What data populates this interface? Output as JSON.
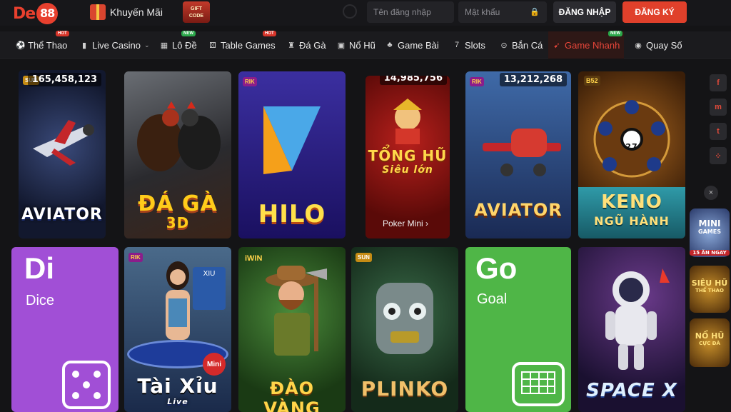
{
  "header": {
    "logo_text": "De",
    "logo_badge": "88",
    "promo_label": "Khuyến Mãi",
    "gift_code": "GIFT CODE",
    "username_placeholder": "Tên đăng nhập",
    "password_placeholder": "Mật khẩu",
    "login_label": "ĐĂNG NHẬP",
    "register_label": "ĐĂNG KÝ"
  },
  "nav": {
    "items": [
      {
        "label": "Thể Thao",
        "icon": "soccer-icon",
        "badge": "HOT"
      },
      {
        "label": "Live Casino",
        "icon": "cards-icon",
        "badge": ""
      },
      {
        "label": "Lô Đề",
        "icon": "lottery-icon",
        "badge": "NEW"
      },
      {
        "label": "Table Games",
        "icon": "dice-icon",
        "badge": "HOT"
      },
      {
        "label": "Đá Gà",
        "icon": "rooster-icon",
        "badge": ""
      },
      {
        "label": "Nổ Hũ",
        "icon": "slot-jar-icon",
        "badge": ""
      },
      {
        "label": "Game Bài",
        "icon": "club-icon",
        "badge": ""
      },
      {
        "label": "Slots",
        "icon": "seven-icon",
        "badge": ""
      },
      {
        "label": "Bắn Cá",
        "icon": "target-icon",
        "badge": ""
      },
      {
        "label": "Game Nhanh",
        "icon": "rocket-icon",
        "badge": "NEW"
      },
      {
        "label": "Quay Số",
        "icon": "ball-icon",
        "badge": ""
      }
    ]
  },
  "games": {
    "aviator1": {
      "title": "AVIATOR",
      "jackpot": "165,458,123",
      "brand": "SUN"
    },
    "daga": {
      "title": "ĐÁ GÀ",
      "sub": "3D"
    },
    "hilo": {
      "title": "HILO",
      "brand": "RIK"
    },
    "tonghu": {
      "title": "TỔNG HŨ",
      "sub": "Siêu lớn",
      "jackpot": "14,985,756",
      "footer": "Poker Mini ›"
    },
    "aviator2": {
      "title": "AVIATOR",
      "jackpot": "13,212,268",
      "brand": "RIK"
    },
    "keno": {
      "title": "KENO",
      "sub": "NGŨ HÀNH",
      "brand": "B52",
      "ball": "27"
    },
    "dice": {
      "big": "Di",
      "label": "Dice"
    },
    "taixiu": {
      "title": "Tài Xỉu",
      "sub": "Live",
      "badge": "Mini",
      "brand": "RIK",
      "panel": "XIU"
    },
    "daovang": {
      "title": "ĐÀO VÀNG",
      "brand": "iWIN"
    },
    "plinko": {
      "title": "PLINKO",
      "brand": "SUN"
    },
    "goal": {
      "big": "Go",
      "label": "Goal"
    },
    "spacex": {
      "title": "SPACE X"
    }
  },
  "sidebar": {
    "social": [
      "f",
      "m",
      "t",
      "⁘"
    ],
    "close": "×",
    "promos": [
      {
        "title": "MINI",
        "sub": "GAMES",
        "tag": "15 ĂN NGAY"
      },
      {
        "title": "SIÊU HŨ",
        "sub": "THỂ THAO",
        "tag": ""
      },
      {
        "title": "NỔ HŨ",
        "sub": "CỰC ĐÃ",
        "tag": ""
      }
    ]
  },
  "colors": {
    "accent": "#e0402b",
    "dice_bg": "#a14fd6",
    "goal_bg": "#4fb647"
  }
}
